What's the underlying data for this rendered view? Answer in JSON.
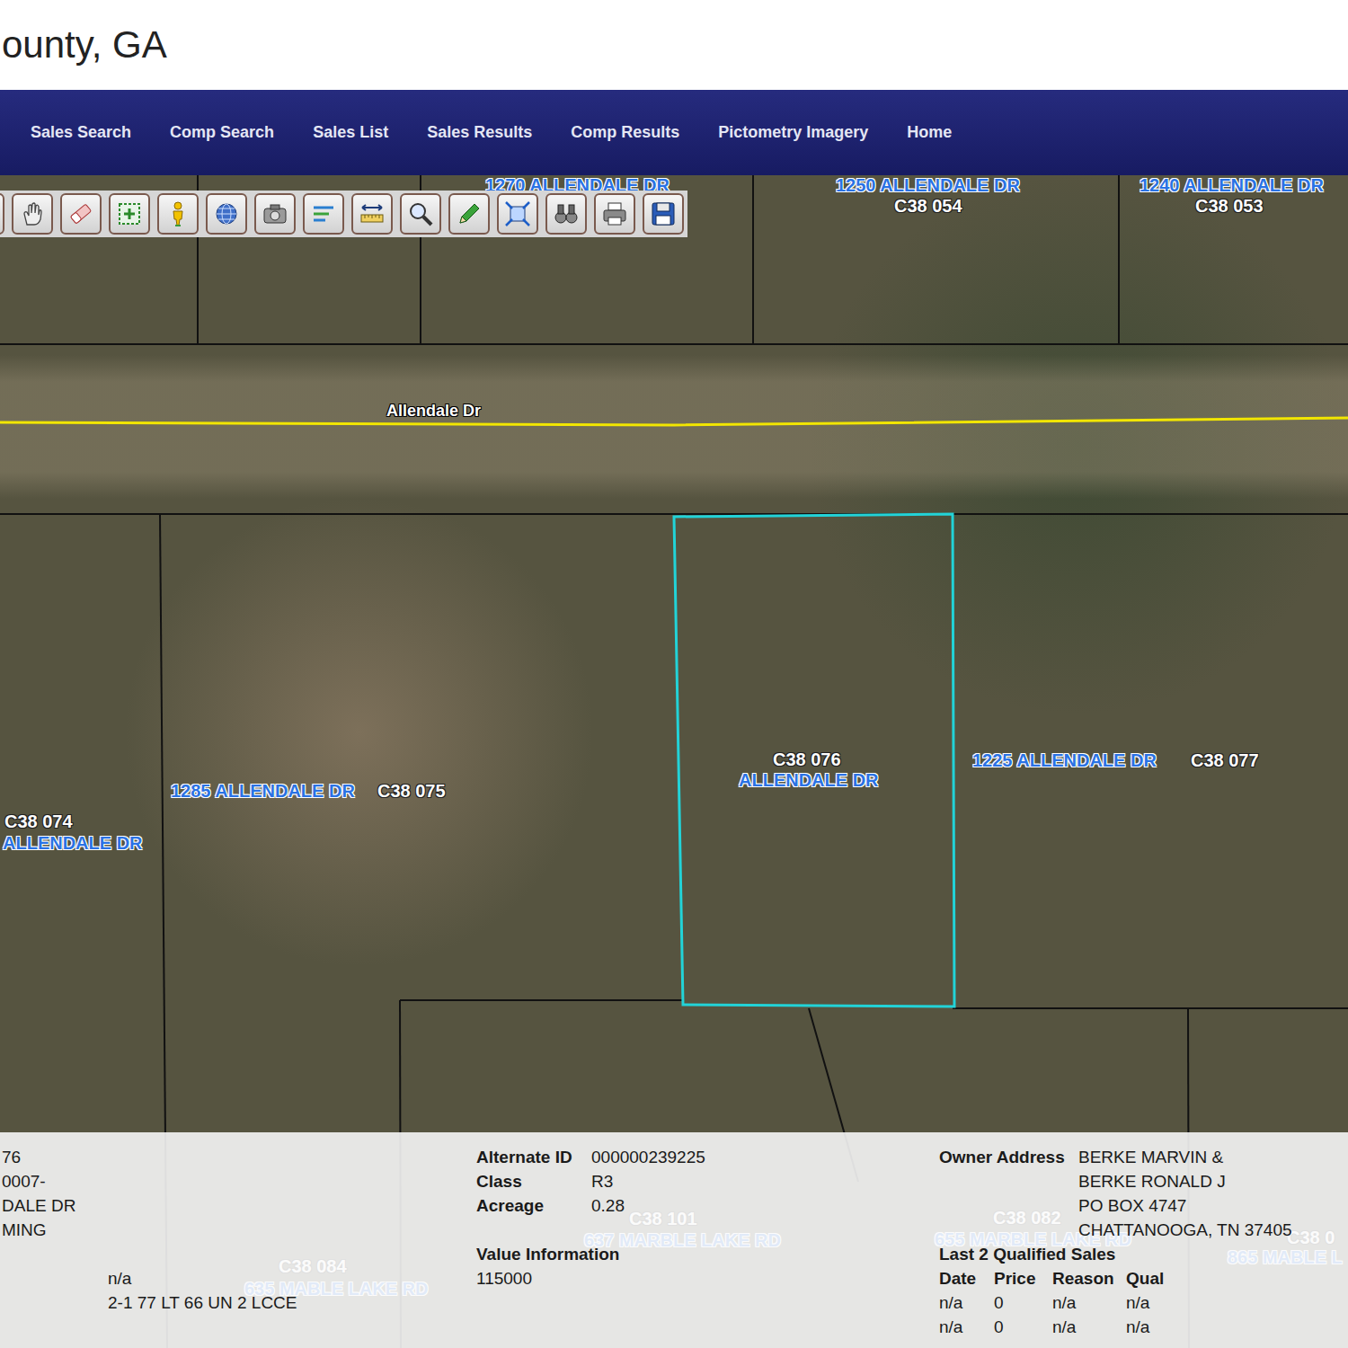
{
  "header": {
    "title": "ounty, GA"
  },
  "nav": [
    {
      "label": "Sales Search",
      "selected": false
    },
    {
      "label": "Comp Search",
      "selected": false
    },
    {
      "label": "Sales List",
      "selected": false
    },
    {
      "label": "Sales Results",
      "selected": false
    },
    {
      "label": "Comp Results",
      "selected": false
    },
    {
      "label": "Pictometry Imagery",
      "selected": false
    },
    {
      "label": "Home",
      "selected": false
    }
  ],
  "map": {
    "selection_visible": true,
    "labels": [
      {
        "text": "1270 ALLENDALE DR",
        "kind": "address"
      },
      {
        "text": "1250 ALLENDALE DR",
        "kind": "address"
      },
      {
        "text": "C38 054",
        "kind": "parcel-id"
      },
      {
        "text": "1240 ALLENDALE DR",
        "kind": "address"
      },
      {
        "text": "C38 053",
        "kind": "parcel-id"
      },
      {
        "text": "Allendale Dr",
        "kind": "road"
      },
      {
        "text": "C38 076",
        "kind": "parcel-id"
      },
      {
        "text": "ALLENDALE DR",
        "kind": "address"
      },
      {
        "text": "1225 ALLENDALE DR",
        "kind": "address"
      },
      {
        "text": "C38 077",
        "kind": "parcel-id"
      },
      {
        "text": "1285 ALLENDALE DR",
        "kind": "address"
      },
      {
        "text": "C38 075",
        "kind": "parcel-id"
      },
      {
        "text": "C38 074",
        "kind": "parcel-id"
      },
      {
        "text": "ALLENDALE DR",
        "kind": "address"
      },
      {
        "text": "C38 101",
        "kind": "parcel-id"
      },
      {
        "text": "637 MARBLE LAKE RD",
        "kind": "address"
      },
      {
        "text": "C38 082",
        "kind": "parcel-id"
      },
      {
        "text": "655 MARBLE LAKE RD",
        "kind": "address"
      },
      {
        "text": "C38 0",
        "kind": "parcel-id"
      },
      {
        "text": "865 MABLE L",
        "kind": "address"
      },
      {
        "text": "C38 084",
        "kind": "parcel-id"
      },
      {
        "text": "635 MABLE LAKE RD",
        "kind": "address"
      }
    ]
  },
  "info": {
    "left_lines": [
      "76",
      "0007-",
      "DALE DR",
      "MING"
    ],
    "left_values": [
      "n/a",
      "2-1 77 LT 66 UN 2 LCCE"
    ],
    "fields": [
      {
        "label": "Alternate ID",
        "value": "000000239225"
      },
      {
        "label": "Class",
        "value": "R3"
      },
      {
        "label": "Acreage",
        "value": "0.28"
      }
    ],
    "value_heading": "Value Information",
    "value": "115000",
    "owner_label": "Owner Address",
    "owner_lines": [
      "BERKE MARVIN &",
      "BERKE RONALD J",
      "PO BOX 4747",
      "CHATTANOOGA, TN 37405"
    ],
    "sales_heading": "Last 2 Qualified Sales",
    "sales_columns": [
      "Date",
      "Price",
      "Reason",
      "Qual"
    ],
    "sales": [
      [
        "n/a",
        "0",
        "n/a",
        "n/a"
      ],
      [
        "n/a",
        "0",
        "n/a",
        "n/a"
      ]
    ]
  }
}
